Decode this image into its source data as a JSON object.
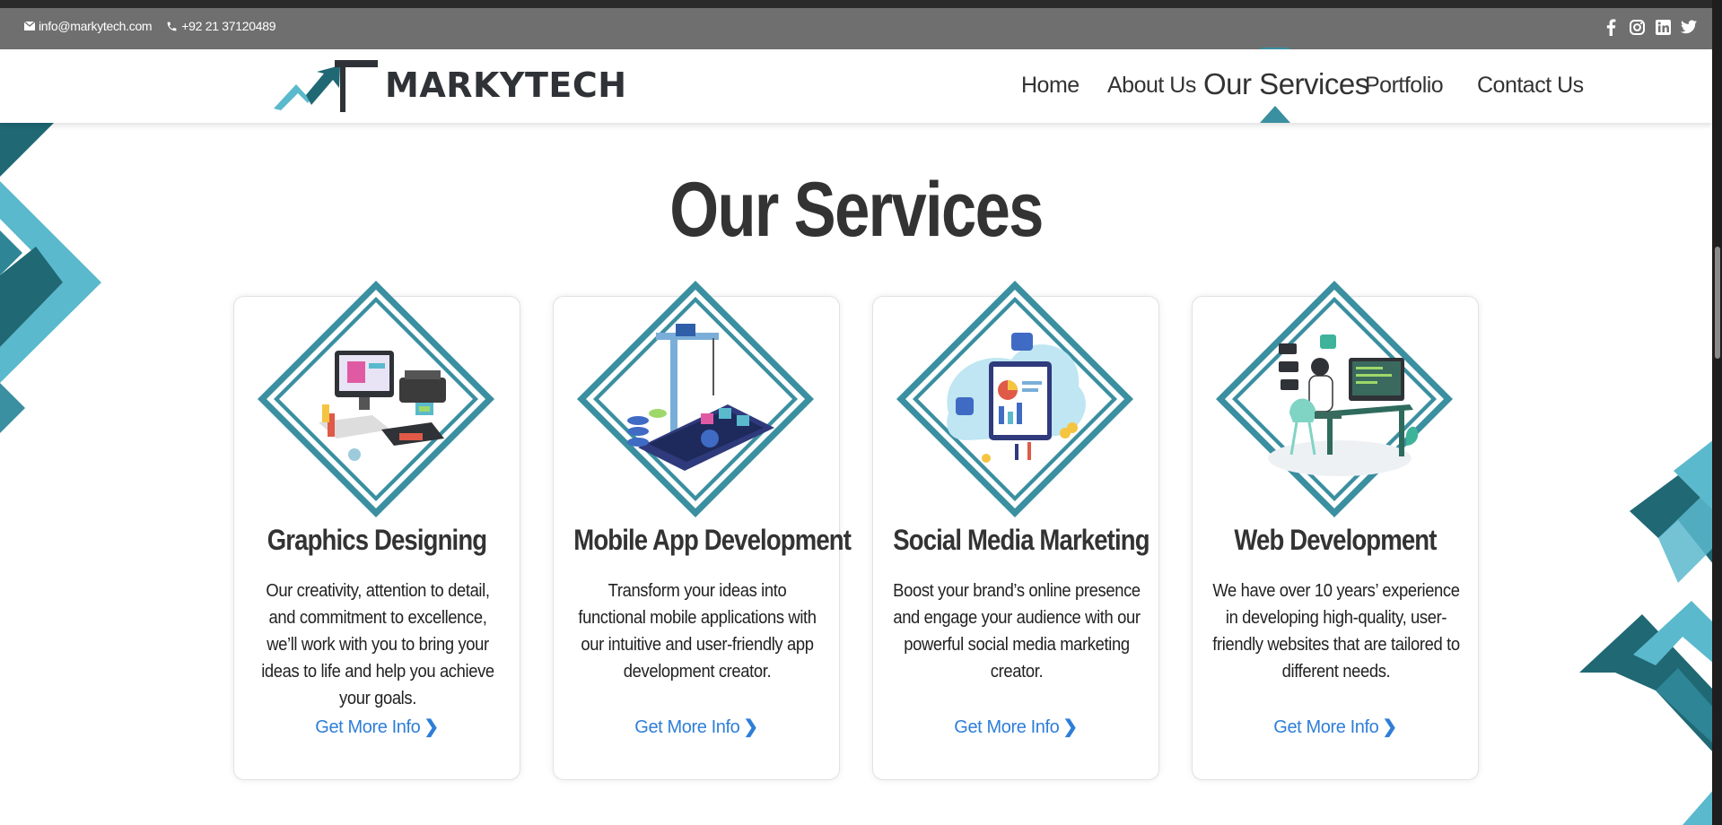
{
  "topbar": {
    "email": "info@markytech.com",
    "phone": "+92 21 37120489",
    "social_icons": [
      "facebook-icon",
      "instagram-icon",
      "linkedin-icon",
      "twitter-icon"
    ]
  },
  "header": {
    "logo_text": "MarkyTech",
    "nav": [
      "Home",
      "About Us",
      "Our Services",
      "Portfolio",
      "Contact Us"
    ],
    "active": "Our Services"
  },
  "section": {
    "title": "Our Services",
    "cards": [
      {
        "title": "Graphics Designing",
        "text": "Our creativity, attention to detail, and commitment to excellence, we’ll work with you to bring your ideas to life and help you achieve your goals.",
        "link": "Get More Info",
        "illustration": "graphics-design-illustration"
      },
      {
        "title": "Mobile App Development",
        "text": "Transform your ideas into functional mobile applications with our intuitive and user-friendly app development creator.",
        "link": "Get More Info",
        "illustration": "mobile-app-illustration"
      },
      {
        "title": "Social Media Marketing",
        "text": "Boost your brand’s online presence and engage your audience with our powerful social media marketing creator.",
        "link": "Get More Info",
        "illustration": "social-media-illustration"
      },
      {
        "title": "Web Development",
        "text": "We have over 10 years’ experience in developing high-quality, user-friendly websites that are tailored to different needs.",
        "link": "Get More Info",
        "illustration": "web-development-illustration"
      }
    ]
  },
  "colors": {
    "accent_teal": "#3a8fa0",
    "light_teal": "#5ab9cc",
    "dark_teal": "#1f6874",
    "link_blue": "#2e7ed8",
    "text_dark": "#333333"
  }
}
